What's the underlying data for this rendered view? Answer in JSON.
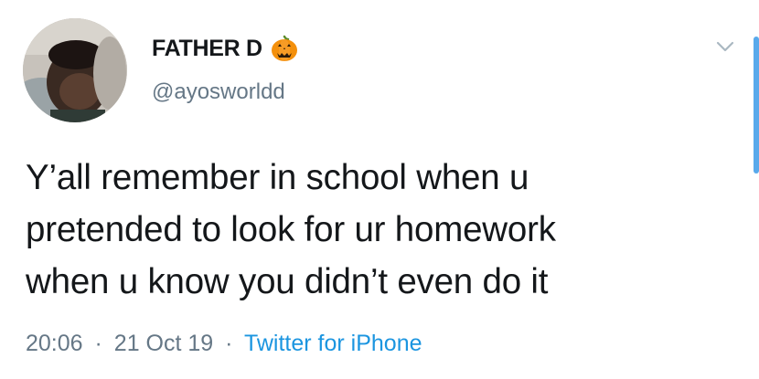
{
  "tweet": {
    "author": {
      "display_name": "FATHER D",
      "name_emoji_icon": "jack-o-lantern-icon",
      "handle": "@ayosworldd"
    },
    "text_lines": [
      "Y’all remember in school when u",
      "pretended to look for ur homework",
      "when u know you didn’t even do it"
    ],
    "time": "20:06",
    "date": "21 Oct 19",
    "separator": "·",
    "source": "Twitter for iPhone",
    "menu_icon": "chevron-down-icon"
  },
  "colors": {
    "text": "#14171a",
    "secondary": "#657786",
    "link": "#1b95e0",
    "pumpkin": "#f4900c"
  }
}
